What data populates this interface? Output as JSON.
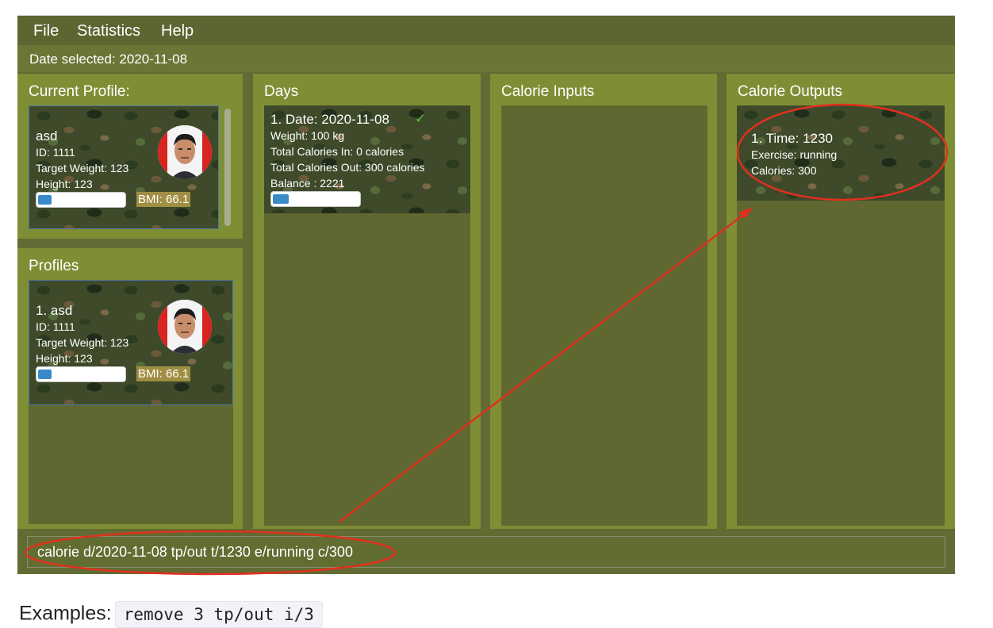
{
  "menu": {
    "items": [
      "File",
      "Statistics",
      "Help"
    ]
  },
  "date_bar": {
    "text": "Date selected: 2020-11-08"
  },
  "current_profile": {
    "title": "Current Profile:",
    "name": "asd",
    "id": "ID: 1111",
    "target_weight": "Target Weight: 123",
    "height": "Height: 123",
    "bmi": "BMI: 66.1",
    "bmi_progress": 0.15
  },
  "profiles": {
    "title": "Profiles",
    "items": [
      {
        "name": "1.  asd",
        "id": "ID: 1111",
        "target_weight": "Target Weight: 123",
        "height": "Height: 123",
        "bmi": "BMI: 66.1",
        "bmi_progress": 0.15
      }
    ]
  },
  "days": {
    "title": "Days",
    "items": [
      {
        "date": "1.  Date: 2020-11-08",
        "check": "✓",
        "weight": "Weight: 100 kg",
        "calories_in": "Total Calories In: 0 calories",
        "calories_out": "Total Calories Out: 300 calories",
        "balance": "Balance : 2221",
        "progress": 0.18
      }
    ]
  },
  "calorie_inputs": {
    "title": "Calorie Inputs",
    "items": []
  },
  "calorie_outputs": {
    "title": "Calorie Outputs",
    "items": [
      {
        "time": "1.  Time: 1230",
        "exercise": "Exercise: running",
        "calories": "Calories: 300"
      }
    ]
  },
  "command": {
    "value": "calorie d/2020-11-08 tp/out t/1230 e/running c/300"
  },
  "examples": {
    "label": "Examples:",
    "code": "remove 3 tp/out i/3"
  },
  "colors": {
    "annotation": "#e0301e",
    "accent": "#3a8ac8",
    "bmi_badge": "#a08f43"
  }
}
